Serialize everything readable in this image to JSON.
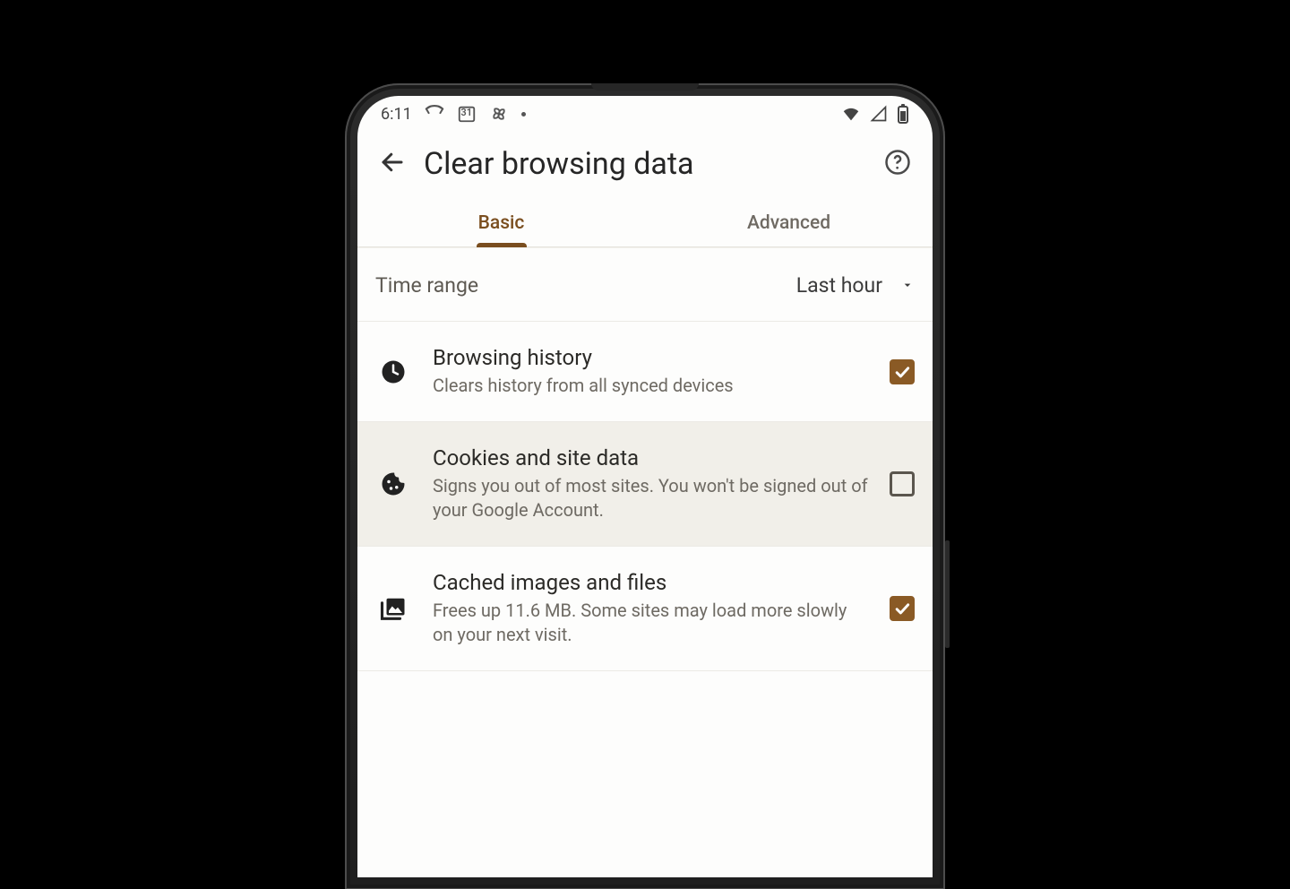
{
  "status": {
    "time": "6:11",
    "calendar_day": "31"
  },
  "appbar": {
    "title": "Clear browsing data"
  },
  "tabs": {
    "basic": "Basic",
    "advanced": "Advanced"
  },
  "time_range": {
    "label": "Time range",
    "value": "Last hour"
  },
  "options": {
    "history": {
      "title": "Browsing history",
      "subtitle": "Clears history from all synced devices",
      "checked": true
    },
    "cookies": {
      "title": "Cookies and site data",
      "subtitle": "Signs you out of most sites. You won't be signed out of your Google Account.",
      "checked": false
    },
    "cache": {
      "title": "Cached images and files",
      "subtitle": "Frees up 11.6 MB. Some sites may load more slowly on your next visit.",
      "checked": true
    }
  }
}
